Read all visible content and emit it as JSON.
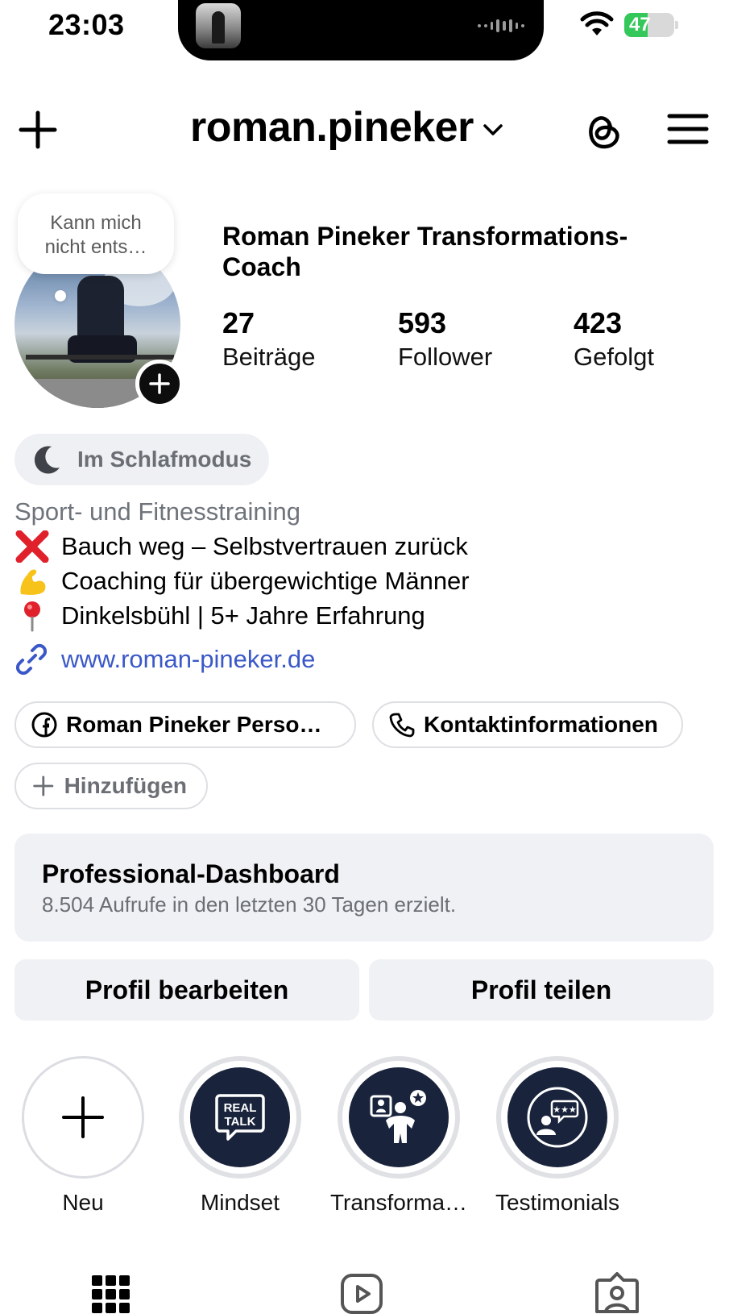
{
  "status_bar": {
    "time": "23:03",
    "battery_percent": "47",
    "battery_level": 0.47
  },
  "header": {
    "username": "roman.pineker",
    "icons": [
      "plus-icon",
      "chevron-down-icon",
      "threads-icon",
      "menu-icon"
    ]
  },
  "profile": {
    "note_line1": "Kann mich",
    "note_line2": "nicht ents…",
    "full_name": "Roman Pineker  Transformations-Coach",
    "stats": {
      "posts_value": "27",
      "posts_label": "Beiträge",
      "followers_value": "593",
      "followers_label": "Follower",
      "following_value": "423",
      "following_label": "Gefolgt"
    }
  },
  "sleep_mode": {
    "label": "Im Schlafmodus"
  },
  "bio": {
    "category": "Sport- und Fitnesstraining",
    "lines": [
      "Bauch weg – Selbstvertrauen zurück",
      "Coaching für übergewichtige Männer",
      "Dinkelsbühl | 5+ Jahre Erfahrung"
    ],
    "link": "www.roman-pineker.de"
  },
  "actions": {
    "facebook": "Roman Pineker  Perso…",
    "contact": "Kontaktinformationen",
    "add": "Hinzufügen"
  },
  "dashboard": {
    "title": "Professional-Dashboard",
    "subtitle": "8.504 Aufrufe in den letzten 30 Tagen erzielt."
  },
  "buttons": {
    "edit": "Profil bearbeiten",
    "share": "Profil teilen"
  },
  "highlights": [
    {
      "label": "Neu"
    },
    {
      "label": "Mindset"
    },
    {
      "label": "Transforma…"
    },
    {
      "label": "Testimonials"
    }
  ],
  "tabs": [
    "grid-icon",
    "reels-icon",
    "tagged-icon"
  ],
  "colors": {
    "accent_link": "#3b58c8",
    "highlight_bg": "#19233c",
    "battery_green": "#34c759"
  }
}
